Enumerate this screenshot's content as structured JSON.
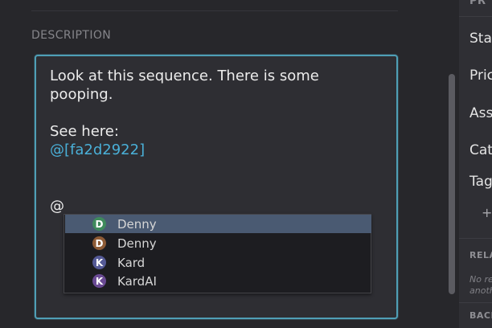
{
  "main": {
    "section_label": "DESCRIPTION",
    "description": {
      "line1": "Look at this sequence. There is some",
      "line2": "pooping.",
      "line3": "See here:",
      "reference": "@[fa2d2922]",
      "typing": "@"
    },
    "mention_popup": {
      "items": [
        {
          "initial": "D",
          "name": "Denny",
          "color": "#3f8a5c",
          "selected": true
        },
        {
          "initial": "D",
          "name": "Denny",
          "color": "#8d5b36",
          "selected": false
        },
        {
          "initial": "K",
          "name": "Kard",
          "color": "#555a96",
          "selected": false
        },
        {
          "initial": "K",
          "name": "KardAI",
          "color": "#6a4a93",
          "selected": false
        }
      ]
    }
  },
  "side_panel": {
    "header": "PR",
    "fields": [
      "Sta",
      "Pric",
      "Ass",
      "Cat",
      "Tag"
    ],
    "add_symbol": "+",
    "related_label": "RELA",
    "related_empty": "No re",
    "related_empty2": "anothe",
    "backlinks_label": "BACK"
  },
  "colors": {
    "accent_border": "#4f9fb6",
    "link": "#4ab0d8",
    "selected_row": "#4a5a72"
  }
}
